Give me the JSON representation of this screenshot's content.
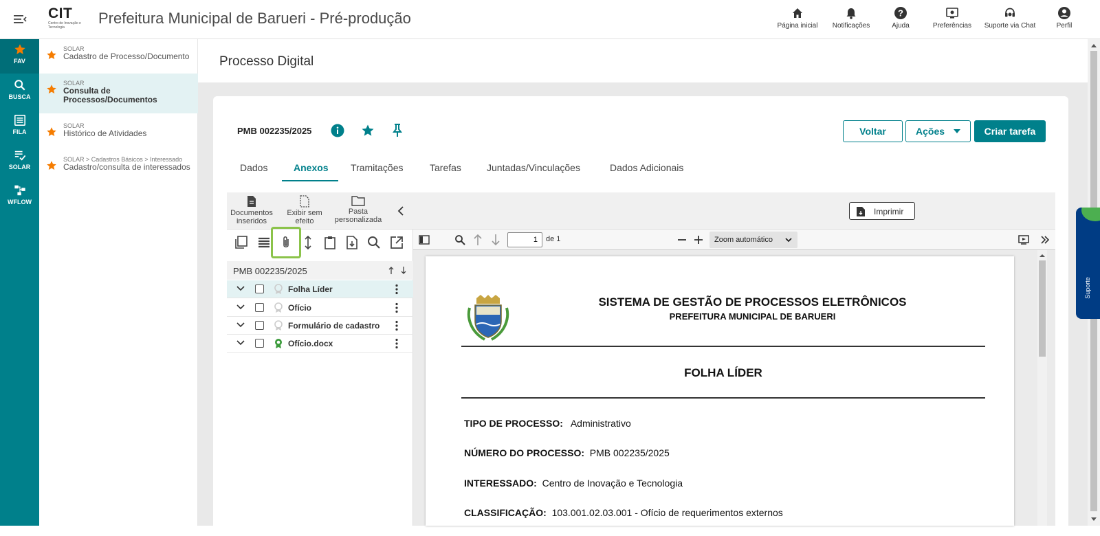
{
  "header": {
    "logo_text": "CIT",
    "logo_subtext": "Centro de Inovação e Tecnologia",
    "title": "Prefeitura Municipal de Barueri - Pré-produção",
    "nav": [
      {
        "label": "Página inicial",
        "icon": "home-icon"
      },
      {
        "label": "Notificações",
        "icon": "bell-icon"
      },
      {
        "label": "Ajuda",
        "icon": "help-icon"
      },
      {
        "label": "Preferências",
        "icon": "preferences-icon"
      },
      {
        "label": "Suporte via Chat",
        "icon": "headset-icon"
      },
      {
        "label": "Perfil",
        "icon": "user-icon"
      }
    ]
  },
  "sidebar": {
    "items": [
      {
        "label": "FAV",
        "icon": "star-icon"
      },
      {
        "label": "BUSCA",
        "icon": "search-icon"
      },
      {
        "label": "FILA",
        "icon": "list-icon"
      },
      {
        "label": "SOLAR",
        "icon": "checklist-icon"
      },
      {
        "label": "WFLOW",
        "icon": "workflow-icon"
      }
    ]
  },
  "favorites": [
    {
      "category": "SOLAR",
      "name": "Cadastro de Processo/Documento"
    },
    {
      "category": "SOLAR",
      "name": "Consulta de Processos/Documentos"
    },
    {
      "category": "SOLAR",
      "name": "Histórico de Atividades"
    },
    {
      "category": "SOLAR > Cadastros Básicos > Interessado",
      "name": "Cadastro/consulta de interessados"
    }
  ],
  "page": {
    "title": "Processo Digital",
    "process_number": "PMB 002235/2025",
    "buttons": {
      "voltar": "Voltar",
      "acoes": "Ações",
      "criar_tarefa": "Criar tarefa"
    },
    "tabs": [
      "Dados",
      "Anexos",
      "Tramitações",
      "Tarefas",
      "Juntadas/Vinculações",
      "Dados Adicionais"
    ],
    "active_tab": "Anexos"
  },
  "attachments": {
    "toolbar": {
      "documentos_inseridos": "Documentos inseridos",
      "exibir_sem_efeito": "Exibir sem efeito",
      "pasta_personalizada": "Pasta personalizada"
    },
    "tree_title": "PMB 002235/2025",
    "items": [
      {
        "label": "Folha Líder",
        "signed": false
      },
      {
        "label": "Ofício",
        "signed": false
      },
      {
        "label": "Formulário de cadastro",
        "signed": false
      },
      {
        "label": "Ofício.docx",
        "signed": true
      }
    ]
  },
  "viewer": {
    "print_label": "Imprimir",
    "page_value": "1",
    "page_of": "de 1",
    "zoom": "Zoom automático",
    "document": {
      "header_title": "SISTEMA DE GESTÃO DE PROCESSOS ELETRÔNICOS",
      "header_subtitle": "PREFEITURA MUNICIPAL DE BARUERI",
      "doc_title": "FOLHA LÍDER",
      "fields": [
        {
          "label": "TIPO DE PROCESSO:",
          "value": "Administrativo"
        },
        {
          "label": "NÚMERO DO PROCESSO:",
          "value": "PMB 002235/2025"
        },
        {
          "label": "INTERESSADO:",
          "value": "Centro de Inovação e Tecnologia"
        },
        {
          "label": "CLASSIFICAÇÃO:",
          "value": "103.001.02.03.001 - Ofício de requerimentos externos"
        }
      ]
    }
  },
  "support_tab": "Suporte",
  "colors": {
    "primary": "#00808b",
    "accent_star": "#f57c00",
    "highlight": "#8bc34a"
  }
}
